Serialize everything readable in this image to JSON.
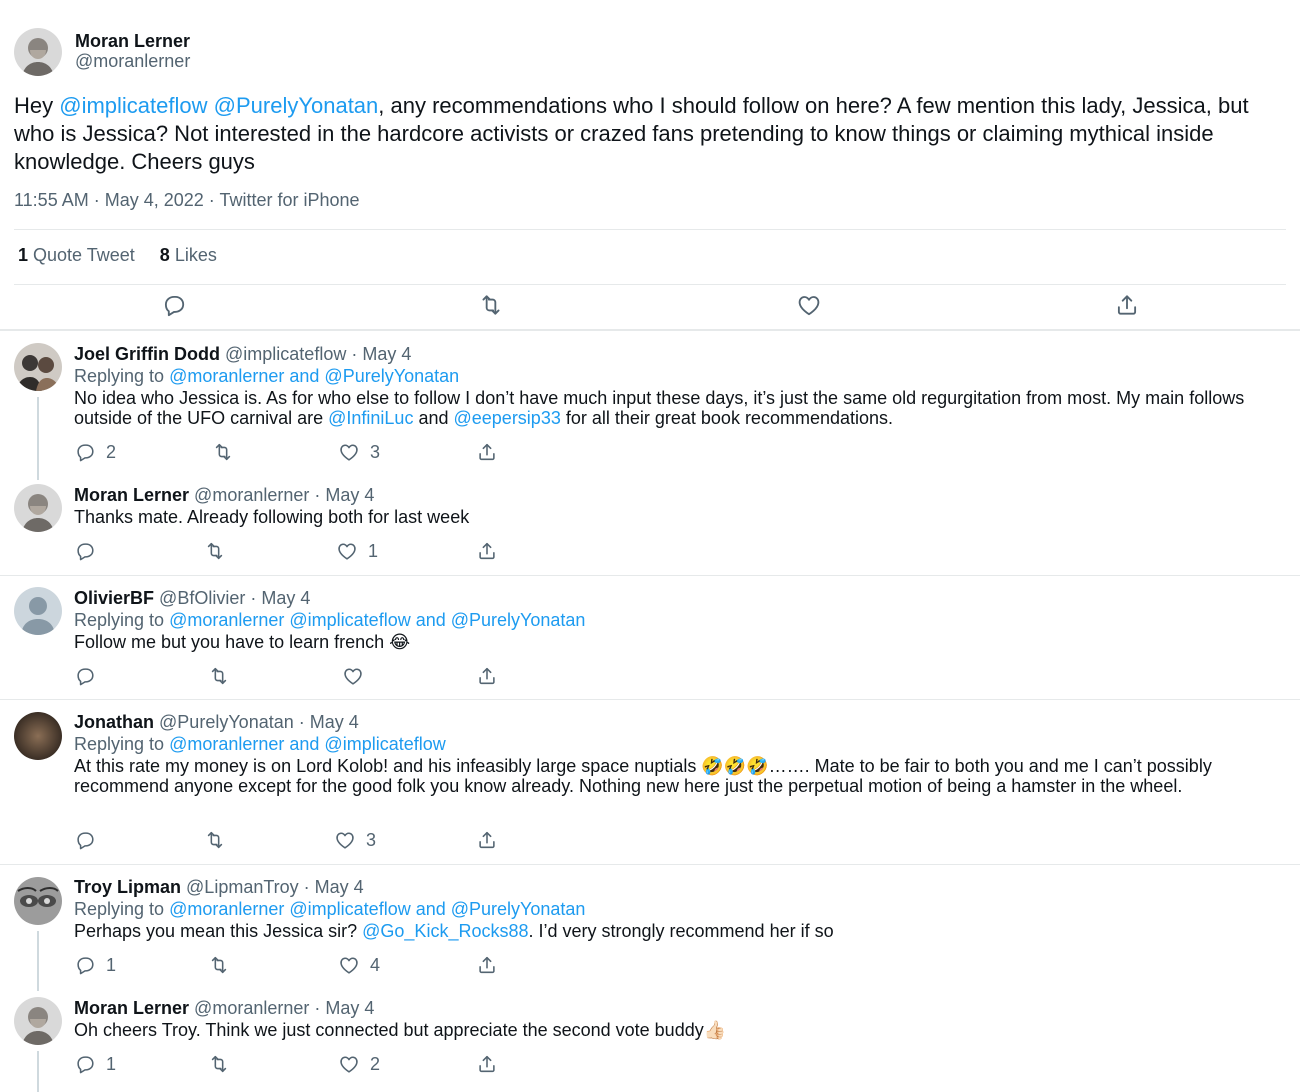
{
  "main_tweet": {
    "name": "Moran Lerner",
    "handle": "@moranlerner",
    "text_prefix": "Hey ",
    "mention_1": "@implicateflow",
    "mention_2": "@PurelyYonatan",
    "text_body": ", any recommendations who I should follow on here? A few mention this lady, Jessica, but who is Jessica? Not interested in the hardcore activists or crazed fans pretending to know things or claiming mythical inside knowledge. Cheers guys",
    "meta": "11:55 AM · May 4, 2022 · Twitter for iPhone",
    "quote_count": "1",
    "quote_label": "Quote Tweet",
    "like_count": "8",
    "like_label": "Likes"
  },
  "replies": [
    {
      "name": "Joel Griffin Dodd",
      "meta": "@implicateflow · May 4",
      "replying_prefix": "Replying to",
      "replying_to": "@moranlerner and @PurelyYonatan",
      "text_a": "No idea who Jessica is. As for who else to follow I don’t have much input these days, it’s just the same old regurgitation from most. My main follows outside of the UFO carnival are ",
      "mention_a": "@InfiniLuc",
      "text_b": " and ",
      "mention_b": "@eepersip33",
      "text_c": " for all their great book recommendations.",
      "reply_count": "2",
      "retweet_count": "",
      "like_count": "3"
    },
    {
      "name": "Moran Lerner",
      "meta": "@moranlerner · May 4",
      "text": "Thanks mate. Already following both for last week",
      "reply_count": "",
      "retweet_count": "",
      "like_count": "1"
    },
    {
      "name": "OlivierBF",
      "meta": "@BfOlivier · May 4",
      "replying_prefix": "Replying to",
      "replying_to": "@moranlerner @implicateflow and @PurelyYonatan",
      "text": "Follow me but you have to learn french ",
      "emoji": "😂",
      "reply_count": "",
      "retweet_count": "",
      "like_count": ""
    },
    {
      "name": "Jonathan",
      "meta": "@PurelyYonatan · May 4",
      "replying_prefix": "Replying to",
      "replying_to": "@moranlerner and @implicateflow",
      "text_a": "At this rate my money is on Lord Kolob! and his infeasibly large space nuptials ",
      "emoji": "🤣🤣🤣",
      "text_b": "……. Mate to be fair to both you and me I can’t possibly recommend anyone except for the good folk you know already. Nothing new here just the perpetual motion of being a hamster in the wheel.",
      "reply_count": "",
      "retweet_count": "",
      "like_count": "3"
    },
    {
      "name": "Troy Lipman",
      "meta": "@LipmanTroy · May 4",
      "replying_prefix": "Replying to",
      "replying_to": "@moranlerner @implicateflow and @PurelyYonatan",
      "text_a": "Perhaps you mean this Jessica sir? ",
      "mention_a": "@Go_Kick_Rocks88",
      "text_b": ". I’d very strongly recommend her if so",
      "reply_count": "1",
      "retweet_count": "",
      "like_count": "4"
    },
    {
      "name": "Moran Lerner",
      "meta": "@moranlerner · May 4",
      "text": "Oh cheers Troy. Think we just connected but appreciate the second vote buddy",
      "emoji": "👍🏻",
      "reply_count": "1",
      "retweet_count": "",
      "like_count": "2"
    }
  ],
  "icons": {
    "reply": "reply-icon",
    "retweet": "retweet-icon",
    "like": "heart-icon",
    "share": "share-icon"
  },
  "colors": {
    "link": "#1d9bf0",
    "muted": "#536471",
    "text": "#0f1419",
    "divider": "#e6e9ea"
  }
}
